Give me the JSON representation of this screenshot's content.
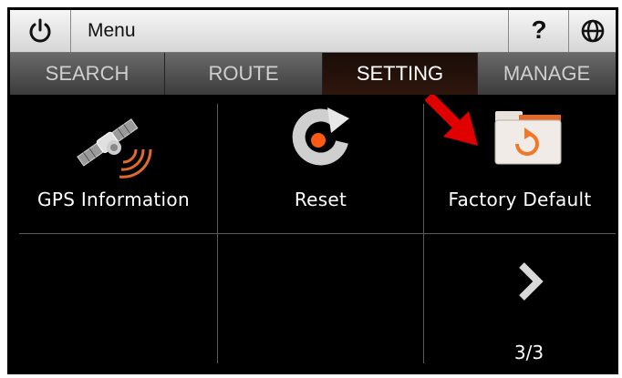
{
  "header": {
    "power_icon": "power-icon",
    "title": "Menu",
    "help_label": "?",
    "globe_icon": "globe-icon"
  },
  "tabs": [
    {
      "label": "SEARCH",
      "active": false
    },
    {
      "label": "ROUTE",
      "active": false
    },
    {
      "label": "SETTING",
      "active": true
    },
    {
      "label": "MANAGE",
      "active": false
    }
  ],
  "items": [
    {
      "label": "GPS Information",
      "icon": "satellite-icon"
    },
    {
      "label": "Reset",
      "icon": "reset-icon"
    },
    {
      "label": "Factory Default",
      "icon": "factory-default-icon"
    }
  ],
  "pagination": {
    "next_icon": "chevron-right-icon",
    "page": "3/3"
  },
  "annotation": {
    "arrow_icon": "red-arrow-icon",
    "color": "#e00000"
  }
}
